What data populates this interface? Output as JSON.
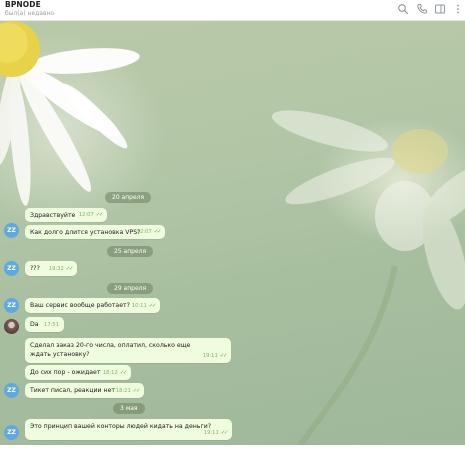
{
  "header": {
    "title": "BPNODE",
    "status": "был(а) недавно",
    "icons": [
      "search-icon",
      "phone-icon",
      "sidebar-toggle-icon",
      "more-icon"
    ]
  },
  "colors": {
    "bubble": "#effdde",
    "meta_text": "#7cb36e",
    "date_chip": "#6e825f",
    "avatar_bg": "#5fa8e0"
  },
  "dates": [
    "20 апреля",
    "25 апреля",
    "29 апреля",
    "3 мая"
  ],
  "messages": [
    {
      "avatar": "",
      "text": "Здравствуйте",
      "time": "12:07"
    },
    {
      "avatar": "ZZ",
      "text": "Как долго длится установка VPS?",
      "time": "12:07"
    },
    {
      "avatar": "ZZ",
      "text": "???",
      "time": "19:32"
    },
    {
      "avatar": "ZZ",
      "text": "Ваш сервис вообще работает?",
      "time": "10:11"
    },
    {
      "avatar": "",
      "text": "Da",
      "time": "17:51"
    },
    {
      "avatar": "",
      "text": "Сделал заказ 20-го числа, оплатил, сколько еще ждать установку?",
      "time": "19:11"
    },
    {
      "avatar": "",
      "text": "До сих пор - ожидает",
      "time": "18:12"
    },
    {
      "avatar": "ZZ",
      "text": "Тикет писал, реакции нет",
      "time": "18:21"
    },
    {
      "avatar": "ZZ",
      "text": "Это принцип вашей конторы людей кидать на деньги?",
      "time": "19:11"
    }
  ]
}
